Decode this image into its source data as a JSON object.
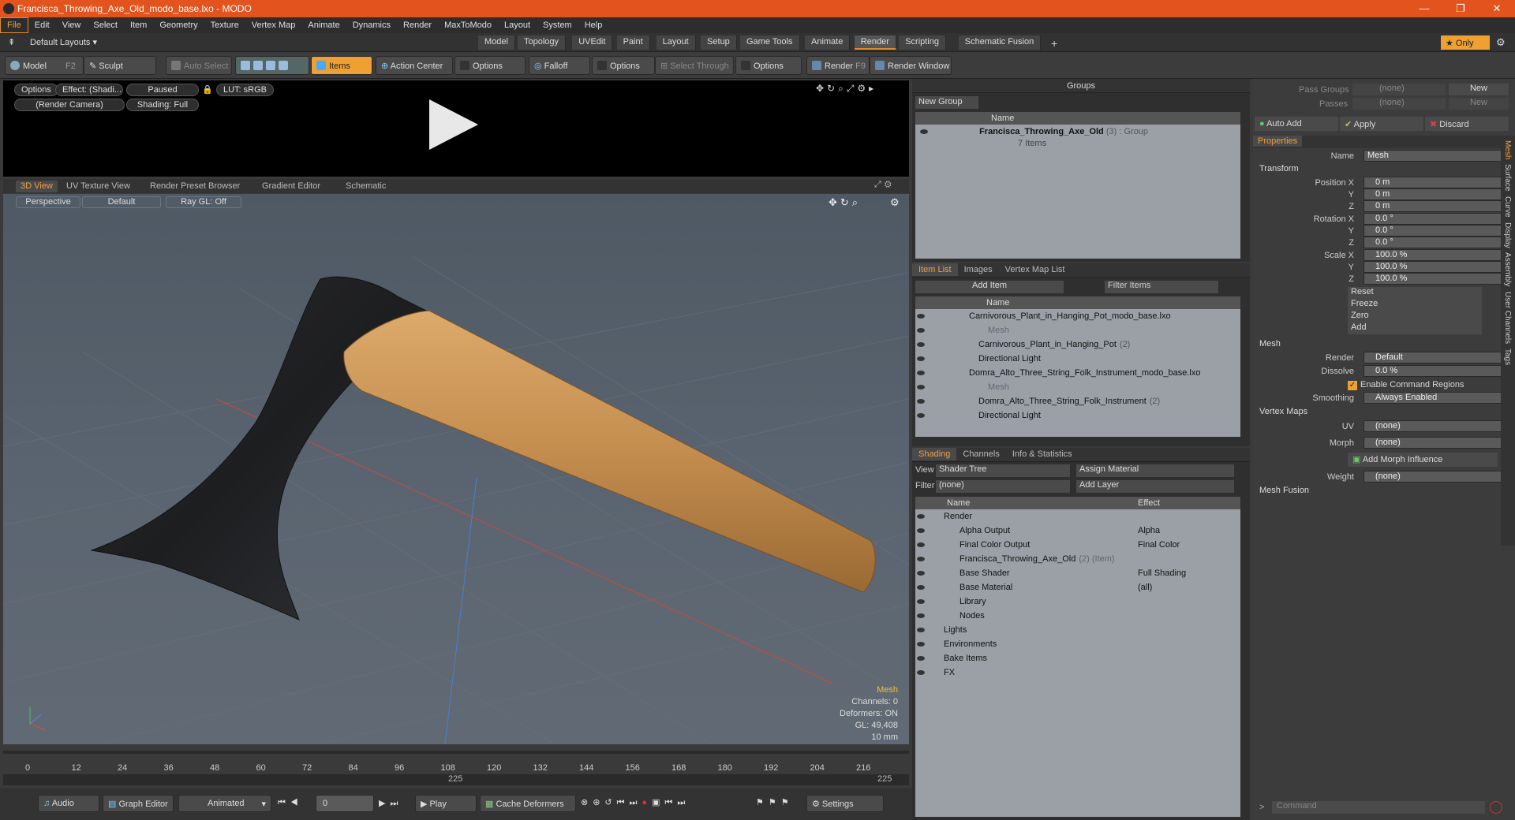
{
  "window": {
    "title": "Francisca_Throwing_Axe_Old_modo_base.lxo - MODO",
    "min": "—",
    "max": "❐",
    "close": "✕"
  },
  "menu": [
    "File",
    "Edit",
    "View",
    "Select",
    "Item",
    "Geometry",
    "Texture",
    "Vertex Map",
    "Animate",
    "Dynamics",
    "Render",
    "MaxToModo",
    "Layout",
    "System",
    "Help"
  ],
  "layout": {
    "preset": "Default Layouts ▾",
    "tabs": [
      "Model",
      "Topology",
      "UVEdit",
      "Paint",
      "Layout",
      "Setup",
      "Game Tools",
      "Animate",
      "Render",
      "Scripting",
      "Schematic Fusion"
    ],
    "active": "Render",
    "only": "★  Only"
  },
  "toolbar": {
    "model": "Model",
    "model_key": "F2",
    "sculpt": "Sculpt",
    "auto_select": "Auto Select",
    "items": "Items",
    "action_center": "Action Center",
    "options1": "Options",
    "falloff": "Falloff",
    "options2": "Options",
    "select_through": "Select Through",
    "options3": "Options",
    "render": "Render",
    "render_key": "F9",
    "render_window": "Render Window"
  },
  "preview": {
    "options": "Options",
    "effect": "Effect: (Shadi...",
    "paused": "Paused",
    "lut": "LUT: sRGB",
    "camera": "(Render Camera)",
    "shading": "Shading: Full"
  },
  "viewtabs": [
    "3D View",
    "UV Texture View",
    "Render Preset Browser",
    "Gradient Editor",
    "Schematic"
  ],
  "viewport": {
    "perspective": "Perspective",
    "default": "Default",
    "raygl": "Ray GL: Off",
    "hud": {
      "title": "Mesh",
      "channels": "Channels: 0",
      "deformers": "Deformers: ON",
      "gl": "GL: 49,408",
      "scale": "10 mm"
    }
  },
  "timeline": {
    "ticks": [
      "0",
      "12",
      "24",
      "36",
      "48",
      "60",
      "72",
      "84",
      "96",
      "108",
      "120",
      "132",
      "144",
      "156",
      "168",
      "180",
      "192",
      "204",
      "216"
    ],
    "sub": "225",
    "end": "225"
  },
  "bottom": {
    "audio": "Audio",
    "graph": "Graph Editor",
    "animated": "Animated",
    "frame": "0",
    "play": "Play",
    "cache": "Cache Deformers",
    "settings": "Settings"
  },
  "groups": {
    "title": "Groups",
    "new_group": "New Group",
    "col_name": "Name",
    "item": "Francisca_Throwing_Axe_Old",
    "count": "(3)",
    "type": ": Group",
    "items": "7 Items"
  },
  "itemlist": {
    "tabs": [
      "Item List",
      "Images",
      "Vertex Map List"
    ],
    "add_item": "Add Item",
    "filter": "Filter Items",
    "col_name": "Name",
    "rows": [
      {
        "indent": 0,
        "label": "Carnivorous_Plant_in_Hanging_Pot_modo_base.lxo",
        "dim": false
      },
      {
        "indent": 2,
        "label": "Mesh",
        "dim": true
      },
      {
        "indent": 1,
        "label": "Carnivorous_Plant_in_Hanging_Pot",
        "count": "(2)",
        "dim": false
      },
      {
        "indent": 1,
        "label": "Directional Light",
        "dim": false
      },
      {
        "indent": 0,
        "label": "Domra_Alto_Three_String_Folk_Instrument_modo_base.lxo",
        "dim": false
      },
      {
        "indent": 2,
        "label": "Mesh",
        "dim": true
      },
      {
        "indent": 1,
        "label": "Domra_Alto_Three_String_Folk_Instrument",
        "count": "(2)",
        "dim": false
      },
      {
        "indent": 1,
        "label": "Directional Light",
        "dim": false
      }
    ]
  },
  "shading": {
    "tabs": [
      "Shading",
      "Channels",
      "Info & Statistics"
    ],
    "view_label": "View",
    "view": "Shader Tree",
    "assign": "Assign Material",
    "filter_label": "Filter",
    "filter": "(none)",
    "add_layer": "Add Layer",
    "col_name": "Name",
    "col_effect": "Effect",
    "rows": [
      {
        "indent": 0,
        "label": "Render",
        "effect": ""
      },
      {
        "indent": 1,
        "label": "Alpha Output",
        "effect": "Alpha"
      },
      {
        "indent": 1,
        "label": "Final Color Output",
        "effect": "Final Color"
      },
      {
        "indent": 1,
        "label": "Francisca_Throwing_Axe_Old",
        "extra": "(2) (Item)",
        "effect": ""
      },
      {
        "indent": 1,
        "label": "Base Shader",
        "effect": "Full Shading"
      },
      {
        "indent": 1,
        "label": "Base Material",
        "effect": "(all)"
      },
      {
        "indent": 1,
        "label": "Library",
        "effect": ""
      },
      {
        "indent": 1,
        "label": "Nodes",
        "effect": ""
      },
      {
        "indent": 0,
        "label": "Lights",
        "effect": ""
      },
      {
        "indent": 0,
        "label": "Environments",
        "effect": ""
      },
      {
        "indent": 0,
        "label": "Bake Items",
        "effect": ""
      },
      {
        "indent": 0,
        "label": "FX",
        "effect": ""
      }
    ]
  },
  "right": {
    "pass_groups": "Pass Groups",
    "passes": "Passes",
    "none": "(none)",
    "new": "New",
    "auto_add": "Auto Add",
    "apply": "Apply",
    "discard": "Discard",
    "properties": "Properties",
    "name_label": "Name",
    "name": "Mesh",
    "transform": "Transform",
    "position": [
      "0 m",
      "0 m",
      "0 m"
    ],
    "rotation": [
      "0.0 °",
      "0.0 °",
      "0.0 °"
    ],
    "scale": [
      "100.0 %",
      "100.0 %",
      "100.0 %"
    ],
    "labels": {
      "posx": "Position X",
      "rotx": "Rotation X",
      "scalex": "Scale X",
      "y": "Y",
      "z": "Z"
    },
    "actions": [
      "Reset",
      "Freeze",
      "Zero",
      "Add"
    ],
    "mesh": "Mesh",
    "render_label": "Render",
    "render": "Default",
    "dissolve_label": "Dissolve",
    "dissolve": "0.0 %",
    "enable_cmd": "Enable Command Regions",
    "smoothing_label": "Smoothing",
    "smoothing": "Always Enabled",
    "vertex_maps": "Vertex Maps",
    "uv_label": "UV",
    "uv": "(none)",
    "morph_label": "Morph",
    "morph": "(none)",
    "add_morph": "Add Morph Influence",
    "weight_label": "Weight",
    "weight": "(none)",
    "mesh_fusion": "Mesh Fusion",
    "side_tabs": [
      "Mesh",
      "Surface",
      "Curve",
      "Display",
      "Assembly",
      "User Channels",
      "Tags"
    ],
    "command": "Command"
  }
}
